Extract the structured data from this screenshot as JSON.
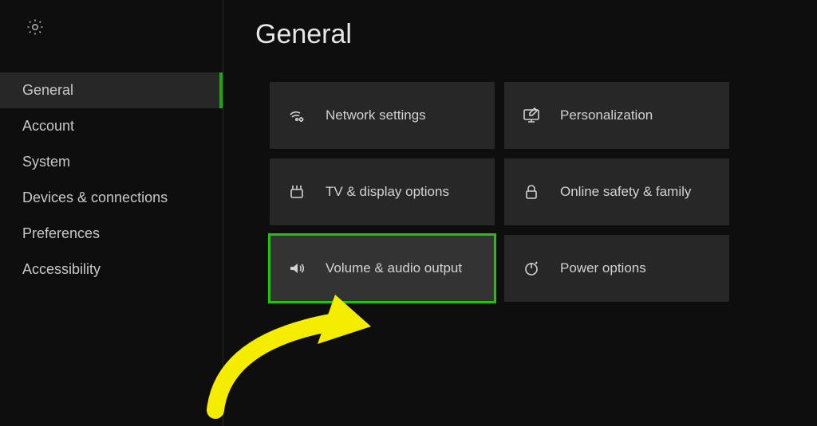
{
  "page": {
    "title": "General"
  },
  "sidebar": {
    "items": [
      {
        "label": "General",
        "selected": true
      },
      {
        "label": "Account",
        "selected": false
      },
      {
        "label": "System",
        "selected": false
      },
      {
        "label": "Devices & connections",
        "selected": false
      },
      {
        "label": "Preferences",
        "selected": false
      },
      {
        "label": "Accessibility",
        "selected": false
      }
    ]
  },
  "tiles": [
    {
      "label": "Network settings",
      "icon": "network",
      "highlight": false
    },
    {
      "label": "Personalization",
      "icon": "personalize",
      "highlight": false
    },
    {
      "label": "TV & display options",
      "icon": "display",
      "highlight": false
    },
    {
      "label": "Online safety & family",
      "icon": "lock",
      "highlight": false
    },
    {
      "label": "Volume & audio output",
      "icon": "volume",
      "highlight": true
    },
    {
      "label": "Power options",
      "icon": "power",
      "highlight": false
    }
  ],
  "colors": {
    "accent": "#22c20f",
    "annotation": "#f5ed00"
  }
}
